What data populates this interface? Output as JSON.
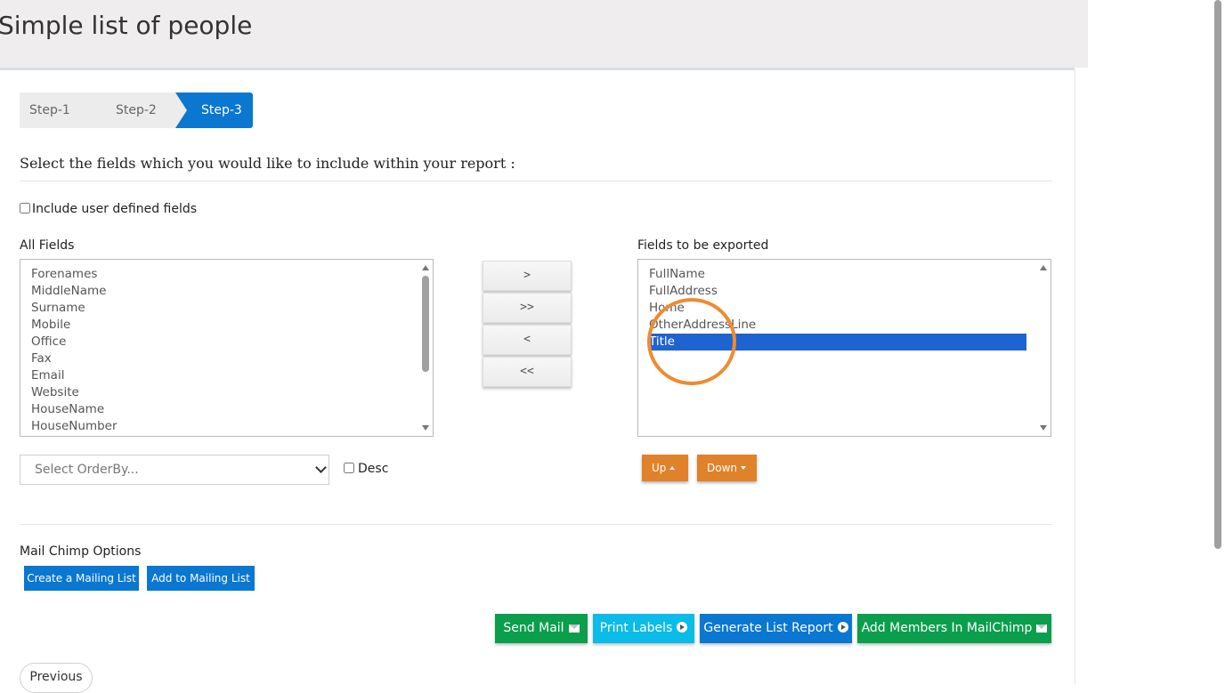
{
  "page": {
    "title": "Simple list of people"
  },
  "steps": [
    {
      "label": "Step-1",
      "active": false
    },
    {
      "label": "Step-2",
      "active": false
    },
    {
      "label": "Step-3",
      "active": true
    }
  ],
  "instructions": "Select the fields which you would like to include within your report :",
  "include_udf": {
    "label": "Include user defined fields",
    "checked": false
  },
  "all_fields": {
    "label": "All Fields",
    "items": [
      "Forenames",
      "MiddleName",
      "Surname",
      "Mobile",
      "Office",
      "Fax",
      "Email",
      "Website",
      "HouseName",
      "HouseNumber"
    ]
  },
  "move_buttons": {
    "add": ">",
    "add_all": ">>",
    "remove": "<",
    "remove_all": "<<"
  },
  "export_fields": {
    "label": "Fields to be exported",
    "items": [
      "FullName",
      "FullAddress",
      "Home",
      "OtherAddressLine",
      "Title"
    ],
    "selected": "Title"
  },
  "orderby": {
    "placeholder": "Select OrderBy..."
  },
  "desc": {
    "label": "Desc",
    "checked": false
  },
  "reorder": {
    "up": "Up",
    "down": "Down"
  },
  "mailchimp": {
    "label": "Mail Chimp Options",
    "create": "Create a Mailing List",
    "add": "Add to Mailing List"
  },
  "actions": {
    "send_mail": "Send Mail",
    "print_labels": "Print Labels",
    "generate_report": "Generate List Report",
    "add_members": "Add Members In MailChimp"
  },
  "nav": {
    "previous": "Previous"
  },
  "colors": {
    "accent_blue": "#0a77d1",
    "selection_blue": "#1f63d0",
    "orange": "#e0822a",
    "green": "#0b9e4d",
    "cyan": "#0bbbe8",
    "highlight_ring": "#f08a30"
  }
}
